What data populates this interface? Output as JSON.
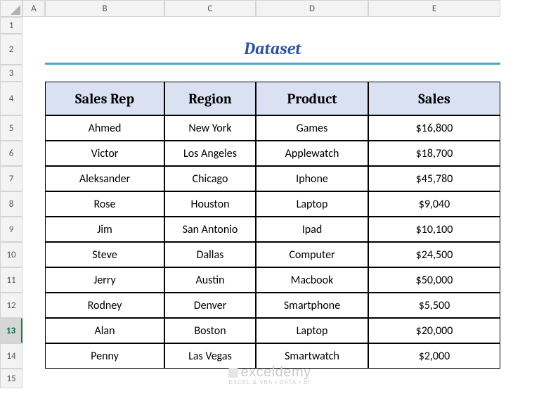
{
  "columns": [
    "A",
    "B",
    "C",
    "D",
    "E"
  ],
  "row_numbers": [
    1,
    2,
    3,
    4,
    5,
    6,
    7,
    8,
    9,
    10,
    11,
    12,
    13,
    14,
    15
  ],
  "selected_row": 13,
  "title": "Dataset",
  "headers": [
    "Sales Rep",
    "Region",
    "Product",
    "Sales"
  ],
  "rows": [
    {
      "rep": "Ahmed",
      "region": "New York",
      "product": "Games",
      "sales": "$16,800"
    },
    {
      "rep": "Victor",
      "region": "Los Angeles",
      "product": "Applewatch",
      "sales": "$18,700"
    },
    {
      "rep": "Aleksander",
      "region": "Chicago",
      "product": "Iphone",
      "sales": "$45,780"
    },
    {
      "rep": "Rose",
      "region": "Houston",
      "product": "Laptop",
      "sales": "$9,040"
    },
    {
      "rep": "Jim",
      "region": "San Antonio",
      "product": "Ipad",
      "sales": "$10,100"
    },
    {
      "rep": "Steve",
      "region": "Dallas",
      "product": "Computer",
      "sales": "$24,500"
    },
    {
      "rep": "Jerry",
      "region": "Austin",
      "product": "Macbook",
      "sales": "$50,000"
    },
    {
      "rep": "Rodney",
      "region": "Denver",
      "product": "Smartphone",
      "sales": "$5,500"
    },
    {
      "rep": "Alan",
      "region": "Boston",
      "product": "Laptop",
      "sales": "$20,000"
    },
    {
      "rep": "Penny",
      "region": "Las Vegas",
      "product": "Smartwatch",
      "sales": "$2,000"
    }
  ],
  "watermark": {
    "brand": "exceldemy",
    "tag": "EXCEL & VBA • DATA • BI"
  }
}
